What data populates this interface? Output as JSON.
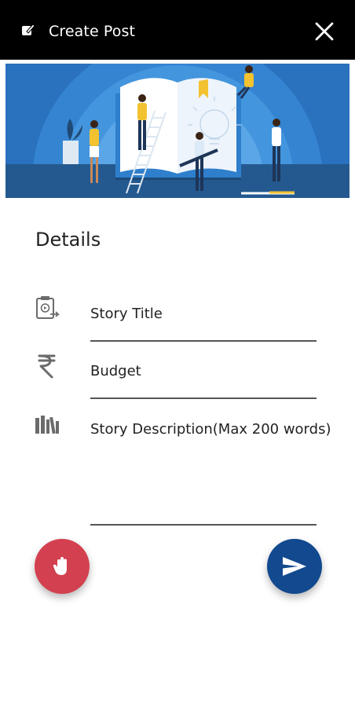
{
  "header": {
    "title": "Create Post",
    "edit_icon": "edit-square-icon",
    "close_icon": "close-icon"
  },
  "banner": {
    "description_icon": "reading-illustration"
  },
  "details": {
    "heading": "Details",
    "fields": [
      {
        "key": "story_title",
        "icon": "book-clip-icon",
        "label": "Story Title"
      },
      {
        "key": "budget",
        "icon": "rupee-icon",
        "label": "Budget"
      },
      {
        "key": "story_description",
        "icon": "library-icon",
        "label": "Story Description(Max 200 words)"
      }
    ]
  },
  "actions": {
    "left_fab_icon": "hand-stop-icon",
    "right_fab_icon": "send-icon"
  },
  "colors": {
    "header_bg": "#000000",
    "banner_blue": "#2d78c8",
    "fab_left": "#d3404f",
    "fab_right": "#12498f"
  }
}
